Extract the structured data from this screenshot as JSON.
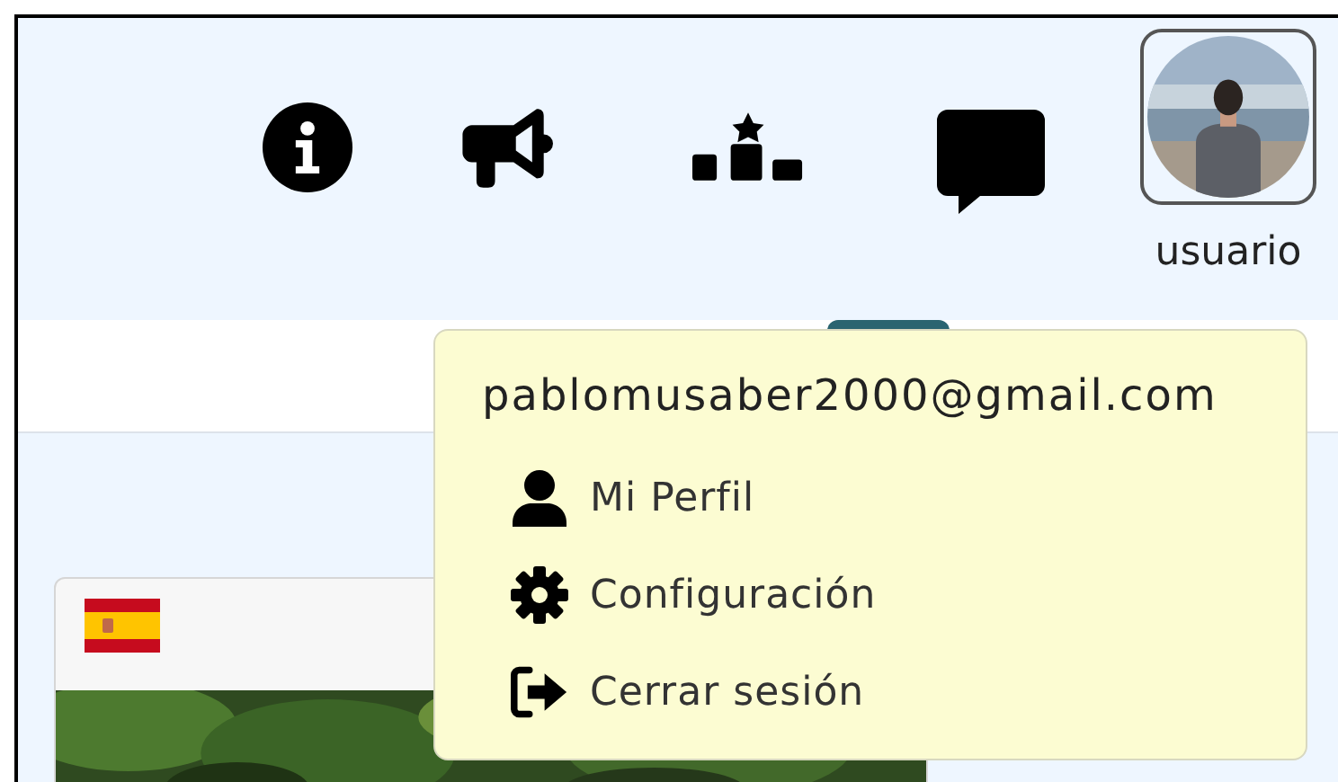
{
  "header": {
    "icons": [
      {
        "kind": "info"
      },
      {
        "kind": "megaphone"
      },
      {
        "kind": "podium"
      },
      {
        "kind": "chat"
      }
    ],
    "user": {
      "name": "usuario"
    }
  },
  "user_menu": {
    "email": "pablomusaber2000@gmail.com",
    "items": [
      {
        "kind": "profile",
        "label": "Mi Perfil"
      },
      {
        "kind": "settings",
        "label": "Configuración"
      },
      {
        "kind": "logout",
        "label": "Cerrar sesión"
      }
    ]
  }
}
